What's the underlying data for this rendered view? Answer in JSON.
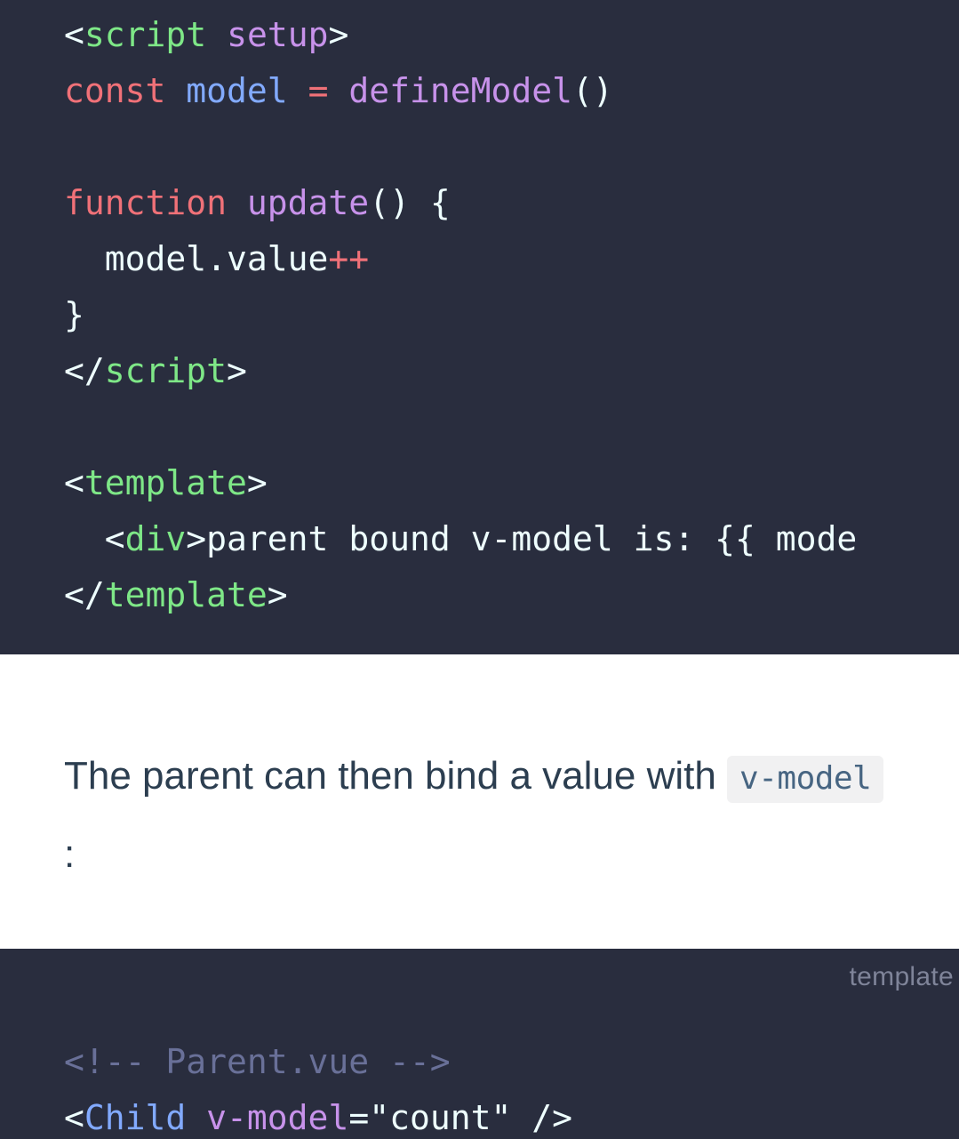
{
  "page": {
    "background": "#ffffff",
    "text_color": "#2c3e50"
  },
  "theme": {
    "code_background": "#292d3e",
    "code_foreground": "#eeffff",
    "tag_color": "#7ee787",
    "attr_color": "#c792ea",
    "keyword_color": "#f07178",
    "variable_color": "#82aaff",
    "function_color": "#c792ea",
    "comment_color": "#697098",
    "component_color": "#82aaff",
    "inline_code_background": "#f1f1f2",
    "inline_code_color": "#476582",
    "lang_label_color": "#7f8499"
  },
  "code_block_top": {
    "language_label": "",
    "lines": [
      {
        "tokens": [
          {
            "text": "<",
            "type": "punct"
          },
          {
            "text": "script",
            "type": "tag"
          },
          {
            "text": " ",
            "type": "plain"
          },
          {
            "text": "setup",
            "type": "attr"
          },
          {
            "text": ">",
            "type": "punct"
          }
        ]
      },
      {
        "tokens": [
          {
            "text": "const",
            "type": "kw"
          },
          {
            "text": " ",
            "type": "plain"
          },
          {
            "text": "model",
            "type": "var"
          },
          {
            "text": " ",
            "type": "plain"
          },
          {
            "text": "=",
            "type": "op"
          },
          {
            "text": " ",
            "type": "plain"
          },
          {
            "text": "defineModel",
            "type": "fn"
          },
          {
            "text": "()",
            "type": "plain"
          }
        ]
      },
      {
        "tokens": []
      },
      {
        "tokens": [
          {
            "text": "function",
            "type": "kw"
          },
          {
            "text": " ",
            "type": "plain"
          },
          {
            "text": "update",
            "type": "fn"
          },
          {
            "text": "() {",
            "type": "plain"
          }
        ]
      },
      {
        "tokens": [
          {
            "text": "  model.value",
            "type": "plain"
          },
          {
            "text": "++",
            "type": "op"
          }
        ]
      },
      {
        "tokens": [
          {
            "text": "}",
            "type": "plain"
          }
        ]
      },
      {
        "tokens": [
          {
            "text": "</",
            "type": "punct"
          },
          {
            "text": "script",
            "type": "tag"
          },
          {
            "text": ">",
            "type": "punct"
          }
        ]
      },
      {
        "tokens": []
      },
      {
        "tokens": [
          {
            "text": "<",
            "type": "punct"
          },
          {
            "text": "template",
            "type": "tag"
          },
          {
            "text": ">",
            "type": "punct"
          }
        ]
      },
      {
        "tokens": [
          {
            "text": "  <",
            "type": "punct"
          },
          {
            "text": "div",
            "type": "tag"
          },
          {
            "text": ">",
            "type": "punct"
          },
          {
            "text": "parent bound v-model is: {{ mode",
            "type": "plain"
          }
        ]
      },
      {
        "tokens": [
          {
            "text": "</",
            "type": "punct"
          },
          {
            "text": "template",
            "type": "tag"
          },
          {
            "text": ">",
            "type": "punct"
          }
        ]
      }
    ]
  },
  "prose": {
    "text_before": "The parent can then bind a value with ",
    "inline_code": "v-model",
    "text_after": " :"
  },
  "code_block_bottom": {
    "language_label": "template",
    "lines": [
      {
        "tokens": [
          {
            "text": "<!-- Parent.vue -->",
            "type": "comment"
          }
        ]
      },
      {
        "tokens": [
          {
            "text": "<",
            "type": "punct"
          },
          {
            "text": "Child",
            "type": "comp"
          },
          {
            "text": " ",
            "type": "plain"
          },
          {
            "text": "v-model",
            "type": "attr"
          },
          {
            "text": "=",
            "type": "plain"
          },
          {
            "text": "\"count\"",
            "type": "str"
          },
          {
            "text": " />",
            "type": "plain"
          }
        ]
      }
    ]
  }
}
